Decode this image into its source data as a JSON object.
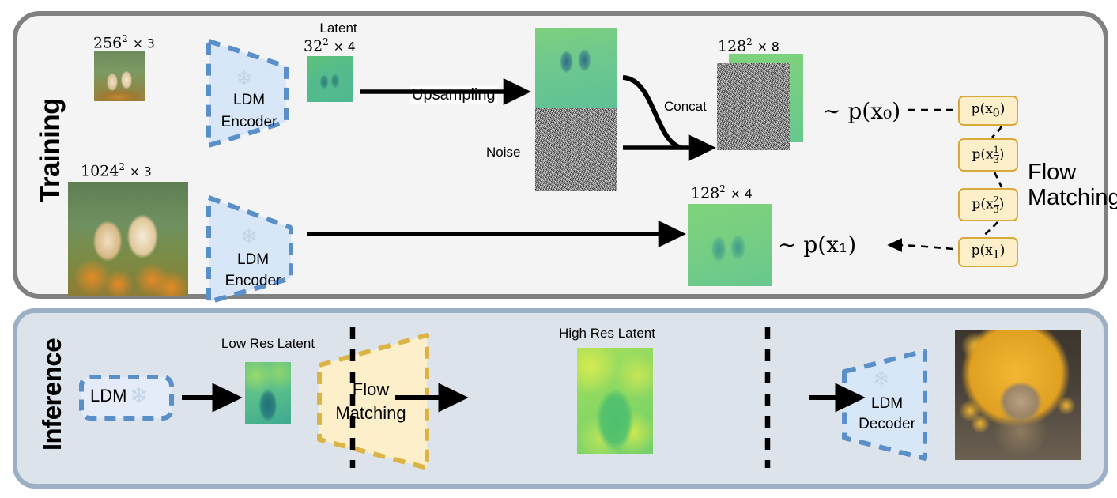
{
  "figure": {
    "type": "pipeline-diagram",
    "panels": [
      "Training",
      "Inference"
    ]
  },
  "training": {
    "label": "Training",
    "row1": {
      "input_caption_base": "256",
      "input_caption_exp": "2",
      "input_caption_rest": "× 3",
      "input_image_alt": "two golden retriever puppies on grass",
      "encoder_line1": "LDM",
      "encoder_line2": "Encoder",
      "encoder_icon": "snowflake-icon",
      "latent_title": "Latent",
      "latent_caption_base": "32",
      "latent_caption_exp": "2",
      "latent_caption_rest": "× 4",
      "upsampling_label": "Upsampling",
      "upsampled_alt": "upsampled latent feature map",
      "noise_label": "Noise",
      "concat_label": "Concat",
      "concat_caption_base": "128",
      "concat_caption_exp": "2",
      "concat_caption_rest": "× 8",
      "sample_x0": "∼ p(x₀)"
    },
    "row2": {
      "input_caption_base": "1024",
      "input_caption_exp": "2",
      "input_caption_rest": "× 3",
      "input_image_alt": "two golden retriever puppies in poppies",
      "encoder_line1": "LDM",
      "encoder_line2": "Encoder",
      "encoder_icon": "snowflake-icon",
      "target_caption_base": "128",
      "target_caption_exp": "2",
      "target_caption_rest": "× 4",
      "sample_x1": "∼ p(x₁)"
    },
    "flow_matching": {
      "title_line1": "Flow",
      "title_line2": "Matching",
      "steps": [
        {
          "label": "p(x",
          "sub": "0",
          "sub_num": "",
          "sub_den": ""
        },
        {
          "label": "p(x",
          "sub": "",
          "sub_num": "1",
          "sub_den": "3"
        },
        {
          "label": "p(x",
          "sub": "",
          "sub_num": "2",
          "sub_den": "3"
        },
        {
          "label": "p(x",
          "sub": "1",
          "sub_num": "",
          "sub_den": ""
        }
      ]
    }
  },
  "inference": {
    "label": "Inference",
    "ldm_box_label": "LDM",
    "ldm_box_icon": "snowflake-icon",
    "low_res_latent_label": "Low Res Latent",
    "low_res_latent_alt": "low resolution capybara latent",
    "flow_matching_line1": "Flow",
    "flow_matching_line2": "Matching",
    "high_res_latent_label": "High Res Latent",
    "high_res_latent_alt": "high resolution capybara latent",
    "decoder_line1": "LDM",
    "decoder_line2": "Decoder",
    "decoder_icon": "snowflake-icon",
    "output_image_alt": "capybara in hot spring with yuzu fruit"
  },
  "colors": {
    "training_panel_bg": "#f4f4f4",
    "training_panel_border": "#808080",
    "inference_panel_bg": "#dde3ea",
    "inference_panel_border": "#9bb0c4",
    "encoder_fill": "#d8e7f7",
    "encoder_stroke": "#5b8fc9",
    "flow_fill": "#fcefc9",
    "flow_stroke": "#d8a93b",
    "arrow": "#000000"
  }
}
